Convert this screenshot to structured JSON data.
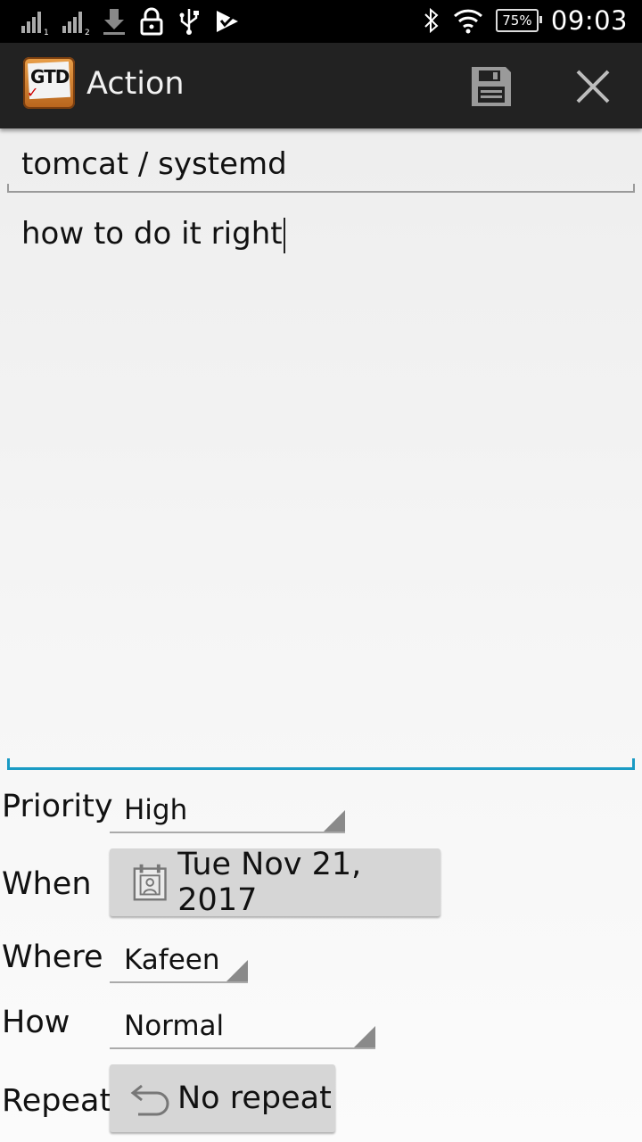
{
  "status_bar": {
    "battery": "75%",
    "time": "09:03",
    "icons": [
      "signal-1-icon",
      "signal-2-icon",
      "download-icon",
      "lock-icon",
      "usb-icon",
      "check-notification-icon",
      "bluetooth-icon",
      "wifi-icon"
    ]
  },
  "action_bar": {
    "logo_text": "GTD",
    "title": "Action"
  },
  "form": {
    "title_value": "tomcat / systemd",
    "body_value": "how to do it right",
    "priority": {
      "label": "Priority",
      "value": "High"
    },
    "when": {
      "label": "When",
      "value": "Tue Nov 21, 2017"
    },
    "where": {
      "label": "Where",
      "value": "Kafeen"
    },
    "how": {
      "label": "How",
      "value": "Normal"
    },
    "repeat": {
      "label": "Repeat",
      "value": "No repeat"
    }
  },
  "colors": {
    "focus_underline": "#1a9bc4",
    "action_bar_bg": "#222222",
    "button_bg": "#d6d6d6"
  }
}
